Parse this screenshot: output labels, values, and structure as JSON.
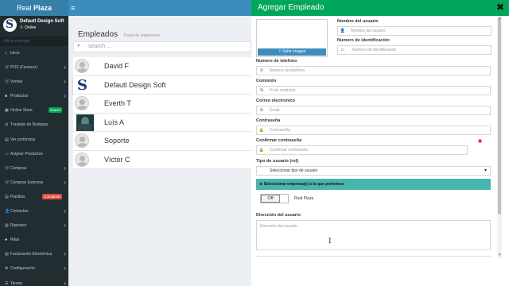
{
  "topbar": {
    "brand_prefix": "Real",
    "brand_bold": "Plaza",
    "menu_icon": "≡"
  },
  "user": {
    "name": "Defautl Design Soft",
    "status": "Online",
    "avatar_letter": "S"
  },
  "sidebar": {
    "header": "Menu principal",
    "items": [
      {
        "icon": "⌂",
        "label": "Inicio",
        "chevron": ""
      },
      {
        "icon": "🛒",
        "label": "POS (Facturar)",
        "chevron": "›"
      },
      {
        "icon": "🛒",
        "label": "Ventas",
        "chevron": "›"
      },
      {
        "icon": "■",
        "label": "Productos",
        "chevron": "›"
      },
      {
        "icon": "▣",
        "label": "Online Store",
        "badge": "Nuevo",
        "badge_color": "green"
      },
      {
        "icon": "⇄",
        "label": "Traslado de Bodegas",
        "chevron": ""
      },
      {
        "icon": "▤",
        "label": "Ver proformas",
        "chevron": ""
      },
      {
        "icon": "▭",
        "label": "Asignar Productos",
        "chevron": ""
      },
      {
        "icon": "🛒",
        "label": "Compras",
        "chevron": "›"
      },
      {
        "icon": "🛒",
        "label": "Compras Externas",
        "chevron": "›"
      },
      {
        "icon": "▤",
        "label": "Planillas",
        "badge": "Completar",
        "badge_color": "red"
      },
      {
        "icon": "👤",
        "label": "Contactos",
        "chevron": "›"
      },
      {
        "icon": "▥",
        "label": "Reportes",
        "chevron": "›"
      },
      {
        "icon": "♣",
        "label": "Rifas",
        "chevron": ""
      },
      {
        "icon": "▤",
        "label": "Facturación Electrónica",
        "chevron": "›"
      },
      {
        "icon": "⚙",
        "label": "Configuración",
        "chevron": "›"
      },
      {
        "icon": "☰",
        "label": "Tareas",
        "chevron": "›"
      }
    ]
  },
  "content": {
    "title": "Empleados",
    "subtitle": "Panel de empleados",
    "search_placeholder": "search ...",
    "employees": [
      {
        "name": "David F",
        "avatar": "default"
      },
      {
        "name": "Defautl Design Soft",
        "avatar": "logo"
      },
      {
        "name": "Everth T",
        "avatar": "default"
      },
      {
        "name": "Luís A",
        "avatar": "photo"
      },
      {
        "name": "Soporte",
        "avatar": "default"
      },
      {
        "name": "Víctor C",
        "avatar": "default"
      }
    ]
  },
  "panel": {
    "title": "Agregar Empleado",
    "close_icon": "✖",
    "upload_button": "Subir imagen",
    "fields": {
      "username_label": "Nombre del usuario",
      "username_placeholder": "Nombre del usuario",
      "id_label": "Numero de identificación",
      "id_placeholder": "Numero de identificacion",
      "phone_label": "Numero de telefono",
      "phone_placeholder": "Numero de telefono",
      "commission_label": "Comisión",
      "commission_placeholder": "% de comisión",
      "email_label": "Correo electronico",
      "email_placeholder": "Email",
      "password_label": "Contraseña",
      "password_placeholder": "Contraseña",
      "confirm_label": "Confirmar contraseña",
      "confirm_placeholder": "Confirmar contraseña",
      "role_label": "Tipo de usuario (rol)",
      "role_value": "Seleccionar tipo de usuario",
      "company_bar": "Seleccionar empresa(s) a la que pertenece",
      "toggle_value": "Off",
      "company_name": "Real Plaza",
      "address_label": "Dirección del usuario",
      "address_placeholder": "Dirección del usuario"
    },
    "required_mark": "*"
  },
  "colors": {
    "topbar": "#3c8dbc",
    "sidebar": "#222d32",
    "panel_header": "#00a65a",
    "company_bar": "#4ab5ae",
    "required": "#ee0000"
  }
}
